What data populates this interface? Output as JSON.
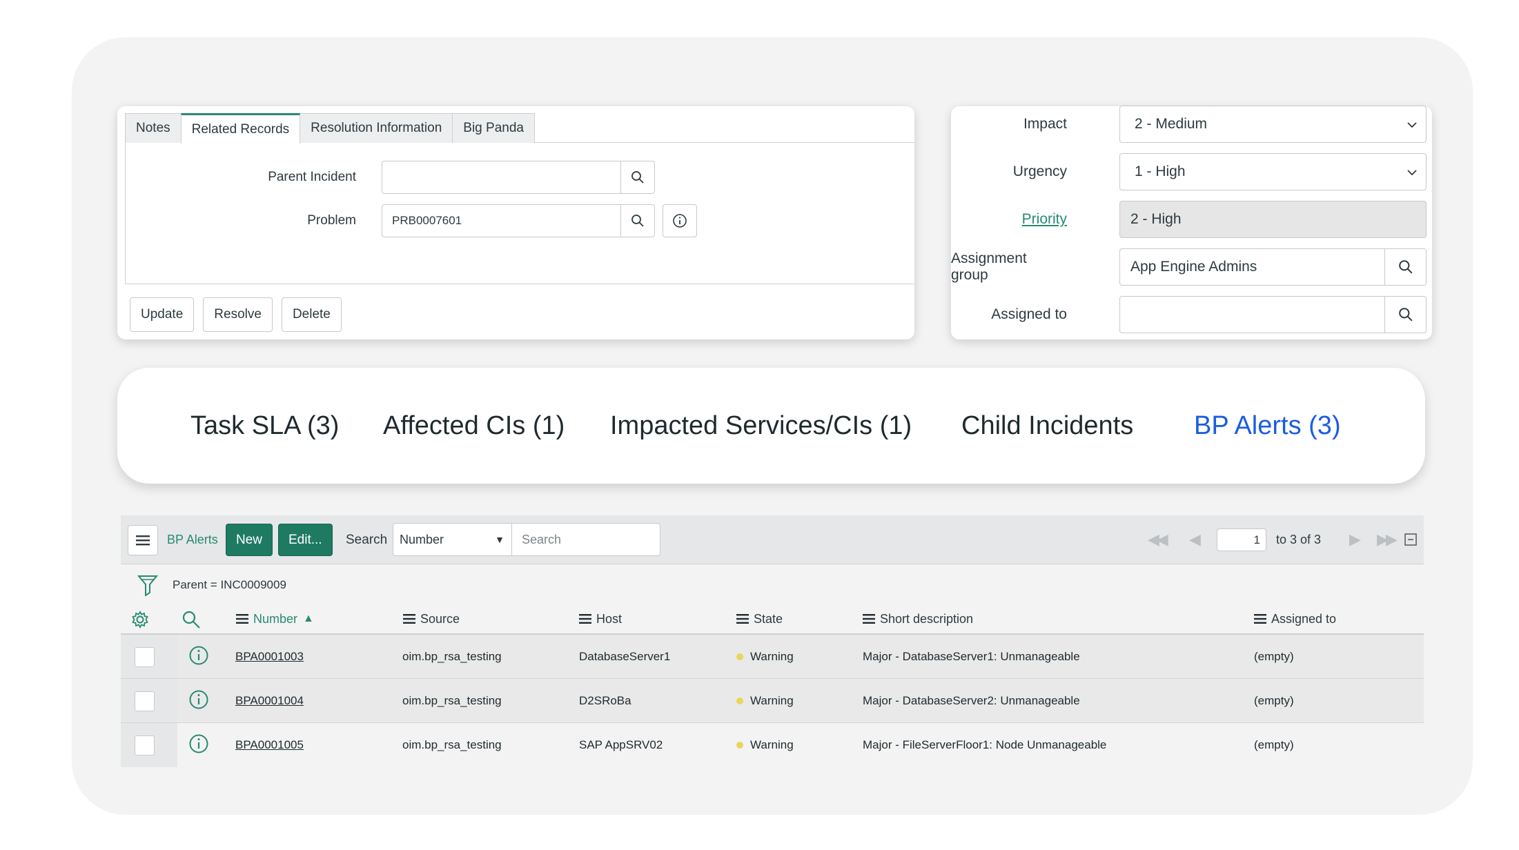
{
  "form": {
    "tabs": [
      {
        "label": "Notes"
      },
      {
        "label": "Related Records"
      },
      {
        "label": "Resolution Information"
      },
      {
        "label": "Big Panda"
      }
    ],
    "active_tab": "Related Records",
    "parent_incident": {
      "label": "Parent Incident",
      "value": ""
    },
    "problem": {
      "label": "Problem",
      "value": "PRB0007601"
    },
    "actions": {
      "update": "Update",
      "resolve": "Resolve",
      "delete": "Delete"
    }
  },
  "fields": {
    "impact": {
      "label": "Impact",
      "value": "2 - Medium"
    },
    "urgency": {
      "label": "Urgency",
      "value": "1 - High"
    },
    "priority": {
      "label": "Priority",
      "value": "2 - High"
    },
    "assignment_group": {
      "label": "Assignment group",
      "value": "App Engine Admins"
    },
    "assigned_to": {
      "label": "Assigned to",
      "value": ""
    }
  },
  "related_lists": {
    "tabs": [
      {
        "label": "Task SLA (3)"
      },
      {
        "label": "Affected CIs (1)"
      },
      {
        "label": "Impacted Services/CIs (1)"
      },
      {
        "label": "Child Incidents"
      },
      {
        "label": "BP Alerts (3)"
      }
    ],
    "active": "BP Alerts (3)",
    "active_color": "#1b5de0"
  },
  "list": {
    "title": "BP Alerts",
    "new_label": "New",
    "edit_label": "Edit...",
    "search_label": "Search",
    "search_field": "Number",
    "search_placeholder": "Search",
    "page_value": "1",
    "page_text": "to 3 of 3",
    "filter": "Parent = INC0009009",
    "columns": {
      "number": "Number",
      "source": "Source",
      "host": "Host",
      "state": "State",
      "short_description": "Short description",
      "assigned_to": "Assigned to"
    },
    "rows": [
      {
        "number": "BPA0001003",
        "source": "oim.bp_rsa_testing",
        "host": "DatabaseServer1",
        "state": "Warning",
        "short_description": "Major - DatabaseServer1: Unmanageable",
        "assigned_to": "(empty)"
      },
      {
        "number": "BPA0001004",
        "source": "oim.bp_rsa_testing",
        "host": "D2SRoBa",
        "state": "Warning",
        "short_description": "Major - DatabaseServer2: Unmanageable",
        "assigned_to": "(empty)"
      },
      {
        "number": "BPA0001005",
        "source": "oim.bp_rsa_testing",
        "host": "SAP AppSRV02",
        "state": "Warning",
        "short_description": "Major - FileServerFloor1: Node Unmanageable",
        "assigned_to": "(empty)"
      }
    ]
  },
  "colors": {
    "accent": "#278a72",
    "button_primary": "#1f7a62",
    "warning_dot": "#e9d65b"
  }
}
